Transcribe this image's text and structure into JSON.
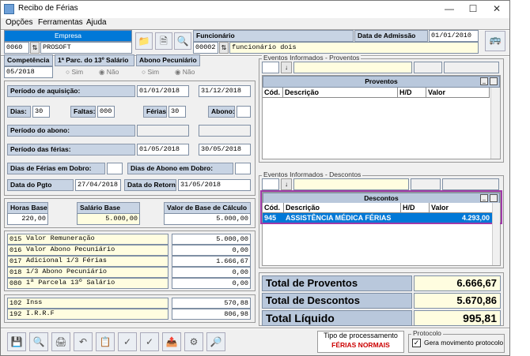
{
  "window": {
    "title": "Recibo de Férias"
  },
  "menu": [
    "Opções",
    "Ferramentas",
    "Ajuda"
  ],
  "empresa": {
    "label": "Empresa",
    "code": "0060",
    "name": "PROSOFT"
  },
  "funcionario": {
    "label": "Funcionário",
    "code": "00002",
    "name": "funcionário dois"
  },
  "admissao": {
    "label": "Data de Admissão",
    "value": "01/01/2010"
  },
  "competencia": {
    "label": "Competência",
    "value": "05/2018"
  },
  "parcela13": {
    "label": "1ª Parc. do 13º Salário",
    "sim": "Sim",
    "nao": "Não"
  },
  "abono": {
    "label": "Abono Pecuniário",
    "sim": "Sim",
    "nao": "Não"
  },
  "periodo_aquisicao": {
    "label": "Período de aquisição:",
    "start": "01/01/2018",
    "end": "31/12/2018"
  },
  "dias": {
    "label": "Dias:",
    "value": "30"
  },
  "faltas": {
    "label": "Faltas:",
    "value": "000"
  },
  "ferias": {
    "label": "Férias:",
    "value": "30"
  },
  "abono_dias": {
    "label": "Abono:",
    "value": ""
  },
  "periodo_abono": {
    "label": "Período do abono:"
  },
  "periodo_ferias": {
    "label": "Período das férias:",
    "start": "01/05/2018",
    "end": "30/05/2018"
  },
  "dias_dobro": {
    "label": "Dias de Férias em Dobro:"
  },
  "abono_dobro": {
    "label": "Dias de Abono em Dobro:"
  },
  "data_pgto": {
    "label": "Data do Pgto",
    "value": "27/04/2018"
  },
  "data_retorno": {
    "label": "Data do Retorno",
    "value": "31/05/2018"
  },
  "horas_base": {
    "label": "Horas Base",
    "value": "220,00"
  },
  "salario_base": {
    "label": "Salário Base",
    "value": "5.000,00"
  },
  "valor_base": {
    "label": "Valor de Base de Cálculo",
    "value": "5.000,00"
  },
  "rubricas": [
    {
      "code": "015",
      "desc": "Valor Remuneração",
      "value": "5.000,00"
    },
    {
      "code": "016",
      "desc": "Valor Abono Pecuniário",
      "value": "0,00"
    },
    {
      "code": "017",
      "desc": "Adicional 1/3 Férias",
      "value": "1.666,67"
    },
    {
      "code": "018",
      "desc": "1/3 Abono Pecuniário",
      "value": "0,00"
    },
    {
      "code": "080",
      "desc": "1ª Parcela 13º Salário",
      "value": "0,00"
    }
  ],
  "descontos_list": [
    {
      "code": "102",
      "desc": "Inss",
      "value": "570,88"
    },
    {
      "code": "192",
      "desc": "I.R.R.F",
      "value": "806,98"
    }
  ],
  "proventos": {
    "group": "Eventos Informados - Proventos",
    "title": "Proventos",
    "cols": [
      "Cód.",
      "Descrição",
      "H/D",
      "Valor"
    ]
  },
  "descontos": {
    "group": "Eventos Informados - Descontos",
    "title": "Descontos",
    "cols": [
      "Cód.",
      "Descrição",
      "H/D",
      "Valor"
    ],
    "row": {
      "code": "945",
      "desc": "ASSISTÊNCIA MÉDICA FÉRIAS",
      "hd": "",
      "value": "4.293,00"
    }
  },
  "totals": {
    "proventos_label": "Total de Proventos",
    "proventos": "6.666,67",
    "descontos_label": "Total de Descontos",
    "descontos": "5.670,86",
    "liquido_label": "Total Líquido",
    "liquido": "995,81"
  },
  "processamento": {
    "label": "Tipo de processamento",
    "value": "FÉRIAS NORMAIS"
  },
  "protocolo": {
    "label": "Protocolo",
    "check": "Gera movimento protocolo"
  },
  "colors": {
    "accent": "#0078d7",
    "highlight": "#a03aa8",
    "label_bg": "#c8d4e4"
  }
}
